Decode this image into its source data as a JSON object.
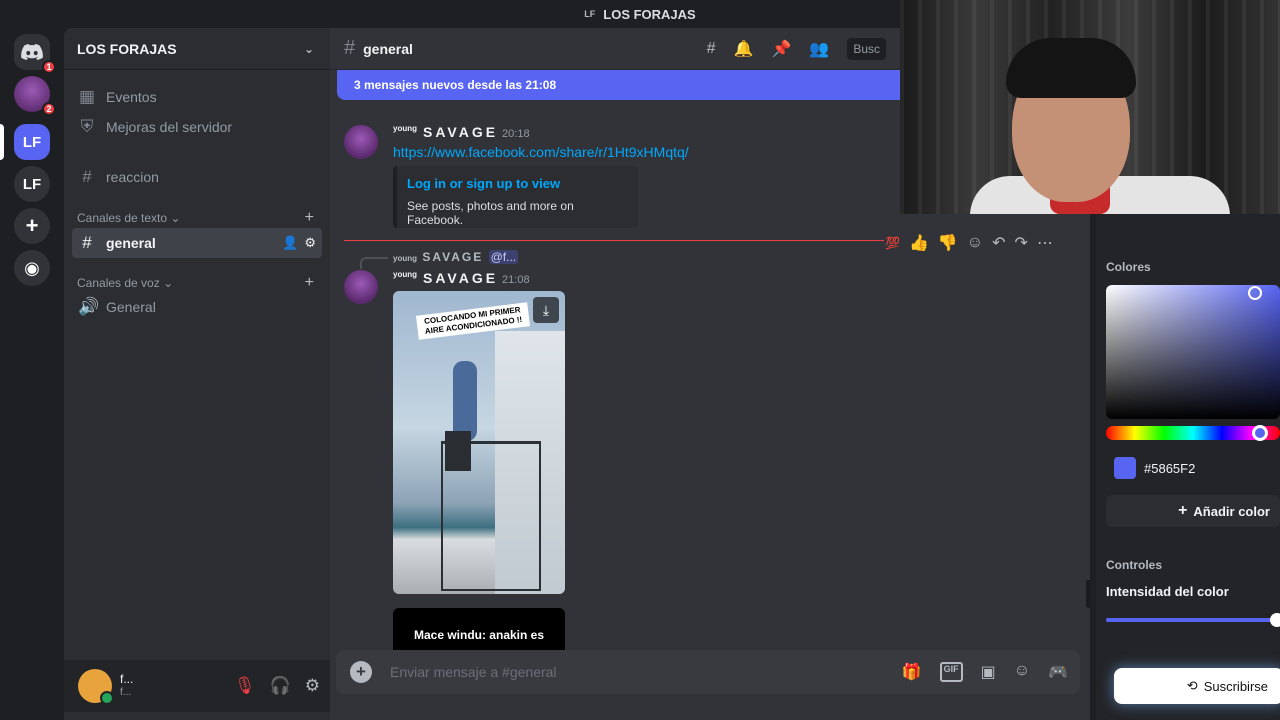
{
  "window": {
    "title": "LOS FORAJAS",
    "mini_icon": "LF"
  },
  "rail": {
    "servers": [
      {
        "label": "",
        "badge": "1"
      },
      {
        "label": "",
        "badge": "2"
      },
      {
        "label": "LF",
        "badge": ""
      },
      {
        "label": "LF",
        "badge": ""
      }
    ]
  },
  "sidebar": {
    "server_name": "LOS FORAJAS",
    "top_items": [
      {
        "label": "Eventos"
      },
      {
        "label": "Mejoras del servidor"
      }
    ],
    "pinned_channel": "reaccion",
    "text_category": "Canales de texto",
    "active_channel": "general",
    "voice_category": "Canales de voz",
    "voice_channel": "General"
  },
  "user": {
    "name": "f...",
    "status": "f..."
  },
  "header": {
    "channel": "general",
    "search_placeholder": "Busc"
  },
  "chat": {
    "new_messages_banner": "3 mensajes nuevos desde las 21:08",
    "msg1": {
      "author_prefix": "young",
      "author": "SAVAGE",
      "time": "20:18",
      "link": "https://www.facebook.com/share/r/1Ht9xHMqtq/",
      "embed_title": "Log in or sign up to view",
      "embed_desc": "See posts, photos and more on Facebook."
    },
    "msg2": {
      "reply_prefix": "young",
      "reply_author": "SAVAGE",
      "reply_mention": "@f...",
      "author_prefix": "young",
      "author": "SAVAGE",
      "time": "21:08",
      "video_caption": "COLOCANDO MI PRIMER AIRE ACONDICIONADO !!",
      "second_media_text": "Mace windu: anakin es"
    }
  },
  "composer": {
    "placeholder": "Enviar mensaje a #general"
  },
  "color_panel": {
    "colors_label": "Colores",
    "hex": "#5865F2",
    "add_color": "Añadir color",
    "controls_label": "Controles",
    "intensity_label": "Intensidad del color",
    "intensity_value": 1.0,
    "accent": "#5865F2"
  },
  "subscribe": {
    "label": "Suscribirse"
  }
}
